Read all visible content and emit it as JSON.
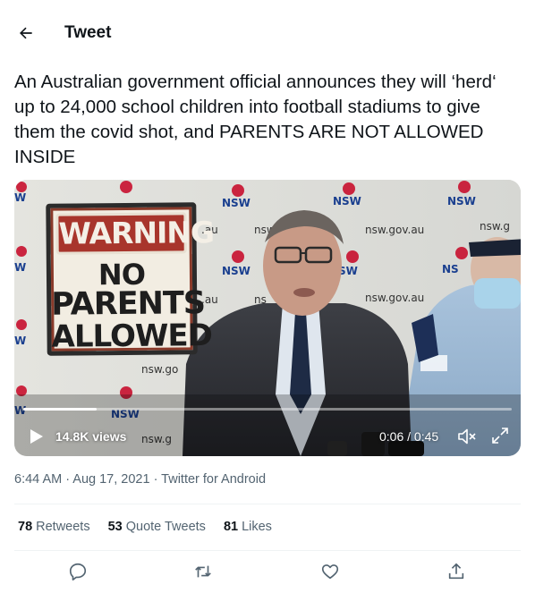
{
  "header": {
    "back_icon": "arrow-left-icon",
    "title": "Tweet"
  },
  "tweet": {
    "text": "An Australian government official announces they will ‘herd‘ up to 24,000 school children into football stadiums to give them the covid shot, and PARENTS ARE NOT ALLOWED INSIDE",
    "timestamp": "6:44 AM · Aug 17, 2021 · Twitter for Android"
  },
  "media": {
    "sign": {
      "heading": "WARNING",
      "line1": "NO",
      "line2": "PARENTS",
      "line3": "ALLOWED"
    },
    "backdrop_texts": [
      "NSW",
      "nsw.gov.au"
    ],
    "views": "14.8K views",
    "timecode": "0:06 / 0:45",
    "progress": 0.15,
    "play_icon": "play-icon",
    "mute_icon": "muted-speaker-icon",
    "fullscreen_icon": "expand-icon",
    "colors": {
      "nsw_red": "#c8102e",
      "nsw_blue": "#1a3f8f",
      "sign_red": "#a8352c"
    }
  },
  "stats": {
    "retweets_count": "78",
    "retweets_label": "Retweets",
    "quotes_count": "53",
    "quotes_label": "Quote Tweets",
    "likes_count": "81",
    "likes_label": "Likes"
  },
  "actions": {
    "reply_icon": "reply-icon",
    "retweet_icon": "retweet-icon",
    "like_icon": "heart-icon",
    "share_icon": "share-icon",
    "icon_color": "#536471"
  },
  "colors": {
    "text_primary": "#0f1419",
    "text_secondary": "#536471",
    "divider": "#eff3f4"
  }
}
